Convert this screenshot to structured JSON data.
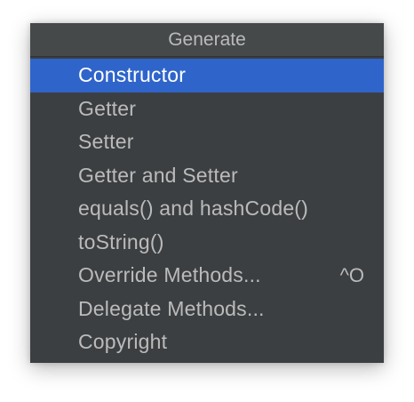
{
  "popup": {
    "title": "Generate",
    "colors": {
      "background": "#3c3f41",
      "header_background": "#45494a",
      "selection": "#2f65ca",
      "text": "#bbbbbb",
      "selected_text": "#ffffff"
    },
    "items": [
      {
        "label": "Constructor",
        "shortcut": "",
        "selected": true
      },
      {
        "label": "Getter",
        "shortcut": ""
      },
      {
        "label": "Setter",
        "shortcut": ""
      },
      {
        "label": "Getter and Setter",
        "shortcut": ""
      },
      {
        "label": "equals() and hashCode()",
        "shortcut": ""
      },
      {
        "label": "toString()",
        "shortcut": ""
      },
      {
        "label": "Override Methods...",
        "shortcut": "^O"
      },
      {
        "label": "Delegate Methods...",
        "shortcut": ""
      },
      {
        "label": "Copyright",
        "shortcut": ""
      }
    ]
  }
}
